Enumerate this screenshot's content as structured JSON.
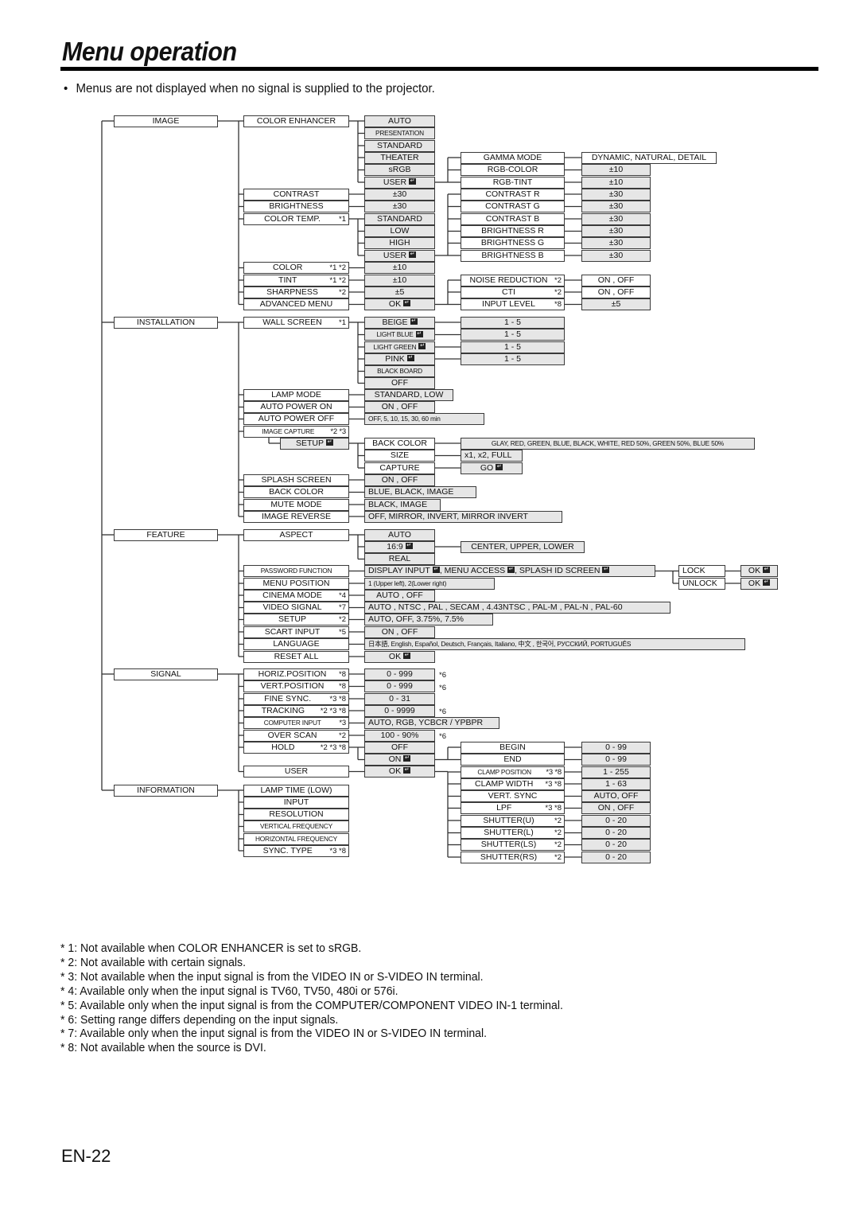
{
  "page": {
    "title": "Menu operation",
    "bullet": "Menus are not displayed when no signal is supplied to the projector.",
    "page_number": "EN-22"
  },
  "menu": {
    "top_level": [
      "IMAGE",
      "INSTALLATION",
      "FEATURE",
      "SIGNAL",
      "INFORMATION"
    ],
    "image": {
      "items": [
        {
          "label": "COLOR ENHANCER",
          "note": ""
        },
        {
          "label": "CONTRAST",
          "note": ""
        },
        {
          "label": "BRIGHTNESS",
          "note": ""
        },
        {
          "label": "COLOR TEMP.",
          "note": "*1"
        },
        {
          "label": "COLOR",
          "note": "*1 *2"
        },
        {
          "label": "TINT",
          "note": "*1 *2"
        },
        {
          "label": "SHARPNESS",
          "note": "*2"
        },
        {
          "label": "ADVANCED MENU",
          "note": ""
        }
      ],
      "color_enhancer_options": [
        "AUTO",
        "PRESENTATION",
        "STANDARD",
        "THEATER",
        "sRGB",
        "USER"
      ],
      "contrast_value": "±30",
      "brightness_value": "±30",
      "color_temp_options": [
        "STANDARD",
        "LOW",
        "HIGH",
        "USER"
      ],
      "color_value": "±10",
      "tint_value": "±10",
      "sharpness_value": "±5",
      "advanced_menu_value": "OK",
      "user_enhancer_items": [
        {
          "label": "GAMMA MODE",
          "value": "DYNAMIC, NATURAL, DETAIL"
        },
        {
          "label": "RGB-COLOR",
          "value": "±10"
        },
        {
          "label": "RGB-TINT",
          "value": "±10"
        }
      ],
      "user_temp_items": [
        {
          "label": "CONTRAST R",
          "value": "±30"
        },
        {
          "label": "CONTRAST G",
          "value": "±30"
        },
        {
          "label": "CONTRAST B",
          "value": "±30"
        },
        {
          "label": "BRIGHTNESS R",
          "value": "±30"
        },
        {
          "label": "BRIGHTNESS G",
          "value": "±30"
        },
        {
          "label": "BRIGHTNESS B",
          "value": "±30"
        }
      ],
      "advanced_items": [
        {
          "label": "NOISE REDUCTION",
          "note": "*2",
          "value": "ON , OFF"
        },
        {
          "label": "CTI",
          "note": "*2",
          "value": "ON , OFF"
        },
        {
          "label": "INPUT LEVEL",
          "note": "*8",
          "value": "±5"
        }
      ]
    },
    "installation": {
      "items": [
        {
          "label": "WALL SCREEN",
          "note": "*1"
        },
        {
          "label": "LAMP MODE",
          "note": ""
        },
        {
          "label": "AUTO POWER ON",
          "note": ""
        },
        {
          "label": "AUTO POWER OFF",
          "note": ""
        },
        {
          "label": "IMAGE CAPTURE",
          "note": "*2 *3"
        },
        {
          "label": "SPLASH SCREEN",
          "note": ""
        },
        {
          "label": "BACK COLOR",
          "note": ""
        },
        {
          "label": "MUTE MODE",
          "note": ""
        },
        {
          "label": "IMAGE REVERSE",
          "note": ""
        }
      ],
      "wall_screen_options": [
        "BEIGE",
        "LIGHT BLUE",
        "LIGHT GREEN",
        "PINK",
        "BLACK BOARD",
        "OFF"
      ],
      "wall_screen_levels": [
        "1 - 5",
        "1 - 5",
        "1 - 5",
        "1 - 5"
      ],
      "lamp_mode_value": "STANDARD, LOW",
      "auto_power_on_value": "ON , OFF",
      "auto_power_off_value": "OFF,  5,  10,  15,  30,  60 min",
      "setup_label": "SETUP",
      "setup_items": [
        {
          "label": "BACK COLOR",
          "value": "GLAY, RED, GREEN, BLUE, BLACK, WHITE, RED 50%, GREEN 50%, BLUE 50%"
        },
        {
          "label": "SIZE",
          "value": "x1, x2, FULL"
        },
        {
          "label": "CAPTURE",
          "value": "GO"
        }
      ],
      "splash_screen_value": "ON , OFF",
      "back_color_value": "BLUE, BLACK, IMAGE",
      "mute_mode_value": "BLACK, IMAGE",
      "image_reverse_value": "OFF, MIRROR, INVERT, MIRROR INVERT"
    },
    "feature": {
      "items": [
        {
          "label": "ASPECT",
          "note": ""
        },
        {
          "label": "PASSWORD FUNCTION",
          "note": ""
        },
        {
          "label": "MENU POSITION",
          "note": ""
        },
        {
          "label": "CINEMA MODE",
          "note": "*4"
        },
        {
          "label": "VIDEO SIGNAL",
          "note": "*7"
        },
        {
          "label": "SETUP",
          "note": "*2"
        },
        {
          "label": "SCART INPUT",
          "note": "*5"
        },
        {
          "label": "LANGUAGE",
          "note": ""
        },
        {
          "label": "RESET ALL",
          "note": ""
        }
      ],
      "aspect_options": [
        "AUTO",
        "16:9",
        "REAL"
      ],
      "aspect_169_value": "CENTER, UPPER, LOWER",
      "password_value": "DISPLAY INPUT , MENU ACCESS , SPLASH ID SCREEN",
      "password_parts": [
        "DISPLAY INPUT",
        ", MENU ACCESS",
        ", SPLASH ID SCREEN"
      ],
      "lock_items": [
        {
          "label": "LOCK",
          "value": "OK"
        },
        {
          "label": "UNLOCK",
          "value": "OK"
        }
      ],
      "menu_position_value": "1 (Upper left), 2(Lower right)",
      "cinema_mode_value": "AUTO , OFF",
      "video_signal_value": "AUTO , NTSC , PAL , SECAM , 4.43NTSC , PAL-M , PAL-N , PAL-60",
      "setup_value": "AUTO, OFF, 3.75%, 7.5%",
      "scart_input_value": "ON , OFF",
      "language_value": "日本語, English, Español, Deutsch, Français, Italiano, 中文 , 한국어, РУССКИЙ, PORTUGUÊS",
      "reset_all_value": "OK"
    },
    "signal": {
      "items": [
        {
          "label": "HORIZ.POSITION",
          "note": "*8",
          "value": "0 - 999",
          "side": "*6"
        },
        {
          "label": "VERT.POSITION",
          "note": "*8",
          "value": "0 - 999",
          "side": "*6"
        },
        {
          "label": "FINE SYNC.",
          "note": "*3 *8",
          "value": "0 - 31",
          "side": ""
        },
        {
          "label": "TRACKING",
          "note": "*2 *3 *8",
          "value": "0 - 9999",
          "side": "*6"
        },
        {
          "label": "COMPUTER INPUT",
          "note": "*3",
          "value": "AUTO, RGB, YCBCR / YPBPR",
          "side": ""
        },
        {
          "label": "OVER SCAN",
          "note": "*2",
          "value": "100 - 90%",
          "side": "*6"
        },
        {
          "label": "HOLD",
          "note": "*2 *3 *8",
          "value": "OFF",
          "side": ""
        },
        {
          "label": "USER",
          "note": "",
          "value": "OK",
          "side": ""
        }
      ],
      "hold_on_value": "ON",
      "computer_input_parts": [
        "AUTO, RGB, YC",
        "B",
        "C",
        "R",
        " / YP",
        "B",
        "P",
        "R"
      ],
      "hold_items": [
        {
          "label": "BEGIN",
          "note": "",
          "value": "0 - 99"
        },
        {
          "label": "END",
          "note": "",
          "value": "0 - 99"
        }
      ],
      "user_items": [
        {
          "label": "CLAMP POSITION",
          "note": "*3 *8",
          "value": "1 - 255"
        },
        {
          "label": "CLAMP WIDTH",
          "note": "*3 *8",
          "value": "1 - 63"
        },
        {
          "label": "VERT. SYNC",
          "note": "",
          "value": "AUTO, OFF"
        },
        {
          "label": "LPF",
          "note": "*3 *8",
          "value": "ON , OFF"
        },
        {
          "label": "SHUTTER(U)",
          "note": "*2",
          "value": "0 - 20"
        },
        {
          "label": "SHUTTER(L)",
          "note": "*2",
          "value": "0 - 20"
        },
        {
          "label": "SHUTTER(LS)",
          "note": "*2",
          "value": "0 - 20"
        },
        {
          "label": "SHUTTER(RS)",
          "note": "*2",
          "value": "0 - 20"
        }
      ]
    },
    "information": {
      "items": [
        {
          "label": "LAMP TIME (LOW)",
          "note": ""
        },
        {
          "label": "INPUT",
          "note": ""
        },
        {
          "label": "RESOLUTION",
          "note": ""
        },
        {
          "label": "VERTICAL FREQUENCY",
          "note": ""
        },
        {
          "label": "HORIZONTAL FREQUENCY",
          "note": ""
        },
        {
          "label": "SYNC. TYPE",
          "note": "*3 *8"
        }
      ]
    },
    "enter_icon": "enter-key-icon"
  },
  "footnotes": [
    "* 1: Not available when COLOR ENHANCER is set to sRGB.",
    "* 2: Not available with certain signals.",
    "* 3: Not available when the input signal is from the VIDEO IN or S-VIDEO IN terminal.",
    "* 4: Available only when the input signal is TV60, TV50, 480i or 576i.",
    "* 5: Available only when the input signal is from the COMPUTER/COMPONENT VIDEO IN-1 terminal.",
    "* 6: Setting range differs depending on the input signals.",
    "* 7: Available only when the input signal is from the VIDEO IN or S-VIDEO IN terminal.",
    "* 8: Not available when the source is DVI."
  ]
}
